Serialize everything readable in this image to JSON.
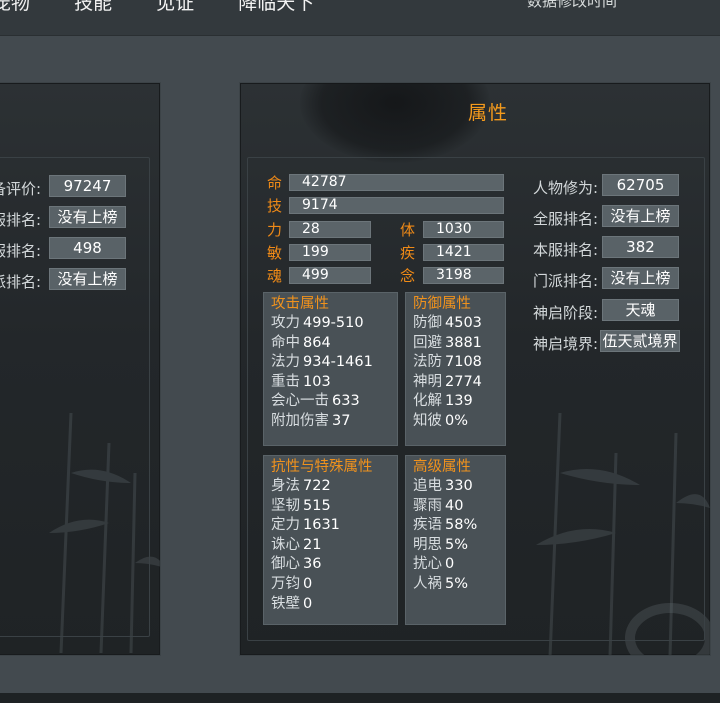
{
  "nav": {
    "items": [
      "宠物",
      "技能",
      "见证",
      "降临天下"
    ],
    "right_text": "数据修改时间"
  },
  "left_panel": {
    "rows": [
      {
        "label": "备评价:",
        "value": "97247"
      },
      {
        "label": "服排名:",
        "value": "没有上榜"
      },
      {
        "label": "服排名:",
        "value": "498"
      },
      {
        "label": "派排名:",
        "value": "没有上榜"
      }
    ]
  },
  "main": {
    "title": "属性",
    "bars": [
      {
        "label": "命",
        "value": "42787"
      },
      {
        "label": "技",
        "value": "9174"
      }
    ],
    "pairs": [
      {
        "label_a": "力",
        "value_a": "28",
        "label_b": "体",
        "value_b": "1030"
      },
      {
        "label_a": "敏",
        "value_a": "199",
        "label_b": "疾",
        "value_b": "1421"
      },
      {
        "label_a": "魂",
        "value_a": "499",
        "label_b": "念",
        "value_b": "3198"
      }
    ],
    "attack": {
      "title": "攻击属性",
      "rows": [
        {
          "name": "攻力",
          "value": "499-510"
        },
        {
          "name": "命中",
          "value": "864"
        },
        {
          "name": "法力",
          "value": "934-1461"
        },
        {
          "name": "重击",
          "value": "103"
        },
        {
          "name": "会心一击",
          "value": "633"
        },
        {
          "name": "附加伤害",
          "value": "37"
        }
      ]
    },
    "defense": {
      "title": "防御属性",
      "rows": [
        {
          "name": "防御",
          "value": "4503"
        },
        {
          "name": "回避",
          "value": "3881"
        },
        {
          "name": "法防",
          "value": "7108"
        },
        {
          "name": "神明",
          "value": "2774"
        },
        {
          "name": "化解",
          "value": "139"
        },
        {
          "name": "知彼",
          "value": "0%"
        }
      ]
    },
    "resist": {
      "title": "抗性与特殊属性",
      "rows": [
        {
          "name": "身法",
          "value": "722"
        },
        {
          "name": "坚韧",
          "value": "515"
        },
        {
          "name": "定力",
          "value": "1631"
        },
        {
          "name": "诛心",
          "value": "21"
        },
        {
          "name": "御心",
          "value": "36"
        },
        {
          "name": "万钧",
          "value": "0"
        },
        {
          "name": "铁壁",
          "value": "0"
        }
      ]
    },
    "advanced": {
      "title": "高级属性",
      "rows": [
        {
          "name": "追电",
          "value": "330"
        },
        {
          "name": "骤雨",
          "value": "40"
        },
        {
          "name": "疾语",
          "value": "58%"
        },
        {
          "name": "明思",
          "value": "5%"
        },
        {
          "name": "扰心",
          "value": "0"
        },
        {
          "name": "人祸",
          "value": "5%"
        }
      ]
    },
    "side": [
      {
        "label": "人物修为:",
        "value": "62705"
      },
      {
        "label": "全服排名:",
        "value": "没有上榜"
      },
      {
        "label": "本服排名:",
        "value": "382"
      },
      {
        "label": "门派排名:",
        "value": "没有上榜"
      },
      {
        "label": "神启阶段:",
        "value": "天魂"
      },
      {
        "label": "神启境界:",
        "value": "伍天贰境界"
      }
    ]
  },
  "colors": {
    "accent_orange": "#f49a1c",
    "box_bg": "#495156",
    "panel_bg": "#23272a"
  }
}
